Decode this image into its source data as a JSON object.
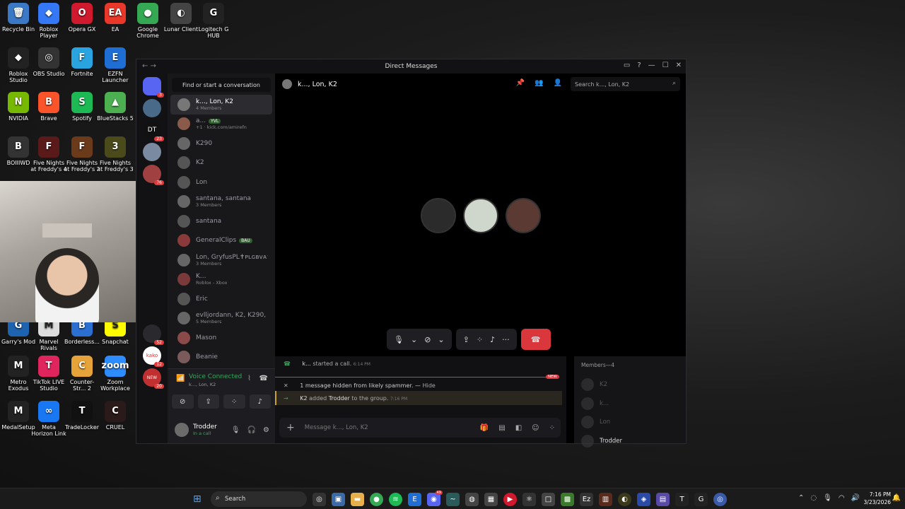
{
  "desktop": {
    "icons": [
      {
        "label": "Recycle Bin",
        "glyph": "🗑",
        "color": "#3b78c6"
      },
      {
        "label": "Roblox Player",
        "glyph": "◆",
        "color": "#3478f6"
      },
      {
        "label": "Opera GX",
        "glyph": "O",
        "color": "#d1192e"
      },
      {
        "label": "EA",
        "glyph": "EA",
        "color": "#e9372a"
      },
      {
        "label": "Google Chrome",
        "glyph": "●",
        "color": "#34a853"
      },
      {
        "label": "Lunar Client",
        "glyph": "◐",
        "color": "#444"
      },
      {
        "label": "Logitech G HUB",
        "glyph": "G",
        "color": "#222"
      },
      {
        "label": "Roblox Studio",
        "glyph": "◆",
        "color": "#222"
      },
      {
        "label": "OBS Studio",
        "glyph": "◎",
        "color": "#333"
      },
      {
        "label": "Fortnite",
        "glyph": "F",
        "color": "#2aa4e0"
      },
      {
        "label": "EZFN Launcher",
        "glyph": "E",
        "color": "#1f6ed4"
      },
      {
        "label": "NVIDIA",
        "glyph": "N",
        "color": "#76b900"
      },
      {
        "label": "Brave",
        "glyph": "B",
        "color": "#fb542b"
      },
      {
        "label": "Spotify",
        "glyph": "S",
        "color": "#1db954"
      },
      {
        "label": "BlueStacks 5",
        "glyph": "▲",
        "color": "#4caf50"
      },
      {
        "label": "BOIIIWD",
        "glyph": "B",
        "color": "#333"
      },
      {
        "label": "Five Nights at Freddy's 4",
        "glyph": "F",
        "color": "#5a1a1a"
      },
      {
        "label": "Five Nights at Freddy's 2",
        "glyph": "F",
        "color": "#6b3a1a"
      },
      {
        "label": "Five Nights at Freddy's 3",
        "glyph": "3",
        "color": "#4a4a1a"
      },
      {
        "label": "Garry's Mod",
        "glyph": "G",
        "color": "#1e63b0"
      },
      {
        "label": "Marvel Rivals",
        "glyph": "M",
        "color": "#ddd"
      },
      {
        "label": "Borderless...",
        "glyph": "B",
        "color": "#2b6fd0"
      },
      {
        "label": "Snapchat",
        "glyph": "S",
        "color": "#fffc00"
      },
      {
        "label": "Metro Exodus",
        "glyph": "M",
        "color": "#222"
      },
      {
        "label": "TikTok LIVE Studio",
        "glyph": "T",
        "color": "#e0245e"
      },
      {
        "label": "Counter-Str... 2",
        "glyph": "C",
        "color": "#e6a33a"
      },
      {
        "label": "Zoom Workplace",
        "glyph": "zoom",
        "color": "#2d8cff"
      },
      {
        "label": "MedalSetup",
        "glyph": "M",
        "color": "#222"
      },
      {
        "label": "Meta Horizon Link",
        "glyph": "∞",
        "color": "#1877f2"
      },
      {
        "label": "TradeLocker",
        "glyph": "T",
        "color": "#111"
      },
      {
        "label": "CRUEL",
        "glyph": "C",
        "color": "#2a1a1a"
      }
    ]
  },
  "discord": {
    "title": "Direct Messages",
    "find_placeholder": "Find or start a conversation",
    "server_badges": [
      "3",
      "23",
      "76",
      "52",
      "12",
      "20",
      "NEW"
    ],
    "dms": [
      {
        "name": "k..., Lon, K2",
        "sub": "4 Members",
        "active": true,
        "color": "#777"
      },
      {
        "name": "a...",
        "tag": "YVL",
        "sub": "+1 · kick.com/amirefn",
        "color": "#8a5a4a"
      },
      {
        "name": "K290",
        "sub": "",
        "color": "#666"
      },
      {
        "name": "K2",
        "sub": "",
        "color": "#555"
      },
      {
        "name": "Lon",
        "sub": "",
        "color": "#555"
      },
      {
        "name": "santana, santana",
        "sub": "3 Members",
        "color": "#666"
      },
      {
        "name": "santana",
        "sub": "",
        "color": "#555"
      },
      {
        "name": "GeneralClips",
        "tag": "BAU",
        "sub": "",
        "color": "#8a3a3a"
      },
      {
        "name": "Lon, GryfusPL✝ᴘʟɢʙᴠᴀ✝",
        "sub": "3 Members",
        "color": "#666"
      },
      {
        "name": "K...",
        "sub": "Roblox - Xbox",
        "color": "#7a3a3a"
      },
      {
        "name": "Eric",
        "sub": "",
        "color": "#555"
      },
      {
        "name": "evlljordann, K2, K290, ...",
        "sub": "5 Members",
        "color": "#666"
      },
      {
        "name": "Mason",
        "sub": "",
        "color": "#8a4a4a"
      },
      {
        "name": "Beanie",
        "sub": "",
        "color": "#7a5a5a"
      }
    ],
    "voice": {
      "status": "Voice Connected",
      "channel": "k..., Lon, K2"
    },
    "user": {
      "name": "Trodder",
      "status": "In a call"
    },
    "channel": {
      "name": "k..., Lon, K2",
      "search_placeholder": "Search k..., Lon, K2"
    },
    "callers": [
      "#2b2b2b",
      "#cfd6cc",
      "#5a3a32"
    ],
    "messages": {
      "call_started": {
        "user": "k...",
        "text": "started a call.",
        "time": "6:14 PM"
      },
      "new_badge": "NEW",
      "hidden": {
        "text": "1 message hidden from likely spammer. —",
        "action": "Hide"
      },
      "added": {
        "actor": "K2",
        "verb": "added",
        "target": "Trodder",
        "rest": "to the group.",
        "time": "7:16 PM"
      }
    },
    "composer_placeholder": "Message k..., Lon, K2",
    "members": {
      "header": "Members—4",
      "list": [
        "K2",
        "k...",
        "Lon",
        "Trodder"
      ]
    }
  },
  "taskbar": {
    "search_label": "Search",
    "time": "7:16 PM",
    "date": "3/23/2026",
    "app_badge": "49"
  }
}
